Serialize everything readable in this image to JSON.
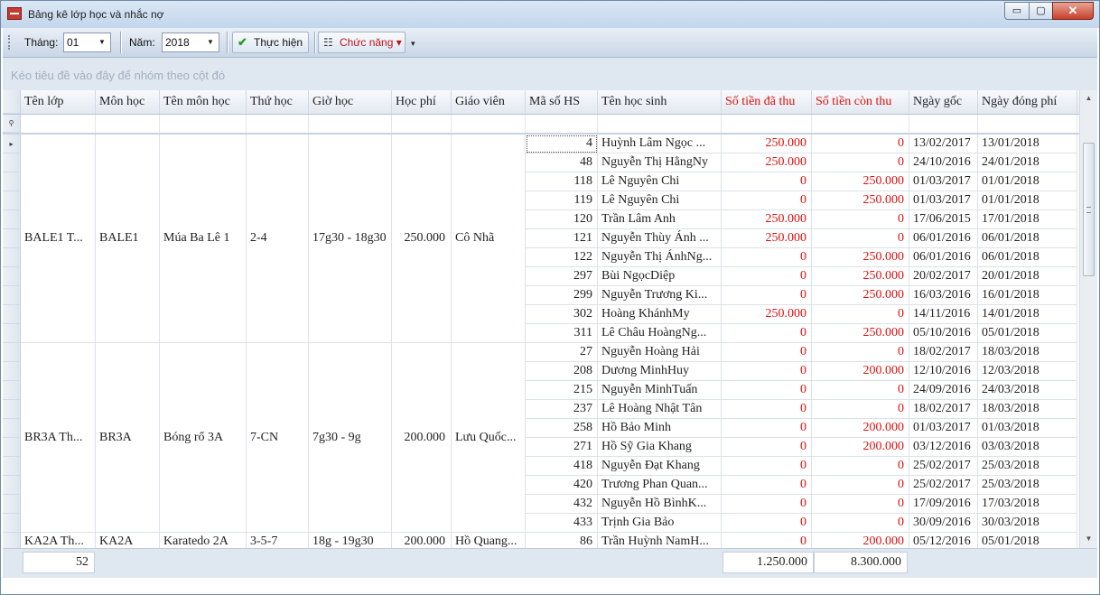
{
  "window": {
    "title": "Bảng kê lớp học và nhắc nợ",
    "min_glyph": "▭",
    "max_glyph": "▢",
    "close_glyph": "✕"
  },
  "toolbar": {
    "month_label": "Tháng:",
    "month_value": "01",
    "year_label": "Năm:",
    "year_value": "2018",
    "execute_label": "Thực hiện",
    "function_label": "Chức năng",
    "dropdown_glyph": "▼",
    "function_arrow": "▾",
    "more_glyph": "▾"
  },
  "group_panel": {
    "hint": "Kéo tiêu đề vào đây để nhóm theo cột đó"
  },
  "colors": {
    "header_red": "#e01010",
    "money_red": "#e01010",
    "accent": "#c0131a"
  },
  "columns": [
    {
      "label": "Tên lớp"
    },
    {
      "label": "Môn học"
    },
    {
      "label": "Tên môn học"
    },
    {
      "label": "Thứ học"
    },
    {
      "label": "Giờ học"
    },
    {
      "label": "Học phí"
    },
    {
      "label": "Giáo viên"
    },
    {
      "label": "Mã số HS"
    },
    {
      "label": "Tên học sinh"
    },
    {
      "label": "Số tiền đã thu",
      "red": true
    },
    {
      "label": "Số tiền còn thu",
      "red": true
    },
    {
      "label": "Ngày gốc"
    },
    {
      "label": "Ngày đóng phí"
    }
  ],
  "groups": [
    {
      "class_name": "BALE1 T...",
      "subject": "BALE1",
      "subject_name": "Múa Ba Lê 1",
      "days": "2-4",
      "time": "17g30 - 18g30",
      "fee": "250.000",
      "teacher": "Cô Nhã",
      "rows": [
        {
          "id": "4",
          "name": "Huỳnh Lâm Ngọc ...",
          "paid": "250.000",
          "remaining": "0",
          "date_orig": "13/02/2017",
          "date_paid": "13/01/2018"
        },
        {
          "id": "48",
          "name": "Nguyễn Thị HằngNy",
          "paid": "250.000",
          "remaining": "0",
          "date_orig": "24/10/2016",
          "date_paid": "24/01/2018"
        },
        {
          "id": "118",
          "name": "Lê Nguyên Chi",
          "paid": "0",
          "remaining": "250.000",
          "date_orig": "01/03/2017",
          "date_paid": "01/01/2018"
        },
        {
          "id": "119",
          "name": "Lê Nguyên Chi",
          "paid": "0",
          "remaining": "250.000",
          "date_orig": "01/03/2017",
          "date_paid": "01/01/2018"
        },
        {
          "id": "120",
          "name": "Trần Lâm Anh",
          "paid": "250.000",
          "remaining": "0",
          "date_orig": "17/06/2015",
          "date_paid": "17/01/2018"
        },
        {
          "id": "121",
          "name": "Nguyễn Thùy Ánh ...",
          "paid": "250.000",
          "remaining": "0",
          "date_orig": "06/01/2016",
          "date_paid": "06/01/2018"
        },
        {
          "id": "122",
          "name": "Nguyễn Thị ÁnhNg...",
          "paid": "0",
          "remaining": "250.000",
          "date_orig": "06/01/2016",
          "date_paid": "06/01/2018"
        },
        {
          "id": "297",
          "name": "Bùi NgọcDiệp",
          "paid": "0",
          "remaining": "250.000",
          "date_orig": "20/02/2017",
          "date_paid": "20/01/2018"
        },
        {
          "id": "299",
          "name": "Nguyễn Trương Ki...",
          "paid": "0",
          "remaining": "250.000",
          "date_orig": "16/03/2016",
          "date_paid": "16/01/2018"
        },
        {
          "id": "302",
          "name": "Hoàng KhánhMy",
          "paid": "250.000",
          "remaining": "0",
          "date_orig": "14/11/2016",
          "date_paid": "14/01/2018"
        },
        {
          "id": "311",
          "name": "Lê Châu HoàngNg...",
          "paid": "0",
          "remaining": "250.000",
          "date_orig": "05/10/2016",
          "date_paid": "05/01/2018"
        }
      ]
    },
    {
      "class_name": "BR3A Th...",
      "subject": "BR3A",
      "subject_name": "Bóng rổ 3A",
      "days": "7-CN",
      "time": "7g30 - 9g",
      "fee": "200.000",
      "teacher": "Lưu Quốc...",
      "rows": [
        {
          "id": "27",
          "name": "Nguyễn Hoàng Hải",
          "paid": "0",
          "remaining": "0",
          "date_orig": "18/02/2017",
          "date_paid": "18/03/2018"
        },
        {
          "id": "208",
          "name": "Dương MinhHuy",
          "paid": "0",
          "remaining": "200.000",
          "date_orig": "12/10/2016",
          "date_paid": "12/03/2018"
        },
        {
          "id": "215",
          "name": "Nguyễn MinhTuấn",
          "paid": "0",
          "remaining": "0",
          "date_orig": "24/09/2016",
          "date_paid": "24/03/2018"
        },
        {
          "id": "237",
          "name": "Lê Hoàng Nhật Tân",
          "paid": "0",
          "remaining": "0",
          "date_orig": "18/02/2017",
          "date_paid": "18/03/2018"
        },
        {
          "id": "258",
          "name": "Hồ Bảo Minh",
          "paid": "0",
          "remaining": "200.000",
          "date_orig": "01/03/2017",
          "date_paid": "01/03/2018"
        },
        {
          "id": "271",
          "name": "Hồ Sỹ Gia Khang",
          "paid": "0",
          "remaining": "200.000",
          "date_orig": "03/12/2016",
          "date_paid": "03/03/2018"
        },
        {
          "id": "418",
          "name": "Nguyễn Đạt Khang",
          "paid": "0",
          "remaining": "0",
          "date_orig": "25/02/2017",
          "date_paid": "25/03/2018"
        },
        {
          "id": "420",
          "name": "Trương Phan Quan...",
          "paid": "0",
          "remaining": "0",
          "date_orig": "25/02/2017",
          "date_paid": "25/03/2018"
        },
        {
          "id": "432",
          "name": "Nguyễn Hồ BìnhK...",
          "paid": "0",
          "remaining": "0",
          "date_orig": "17/09/2016",
          "date_paid": "17/03/2018"
        },
        {
          "id": "433",
          "name": "Trịnh Gia Bảo",
          "paid": "0",
          "remaining": "0",
          "date_orig": "30/09/2016",
          "date_paid": "30/03/2018"
        }
      ]
    },
    {
      "class_name": "KA2A Th...",
      "subject": "KA2A",
      "subject_name": "Karatedo 2A",
      "days": "3-5-7",
      "time": "18g - 19g30",
      "fee": "200.000",
      "teacher": "Hồ Quang...",
      "rows": [
        {
          "id": "86",
          "name": "Trần Huỳnh NamH...",
          "paid": "0",
          "remaining": "200.000",
          "date_orig": "05/12/2016",
          "date_paid": "05/01/2018"
        }
      ]
    }
  ],
  "footer": {
    "count": "52",
    "total_paid": "1.250.000",
    "total_remaining": "8.300.000"
  },
  "scroll": {
    "up_glyph": "▲",
    "down_glyph": "▼"
  },
  "indicator": {
    "filter_glyph": "⚲",
    "current_glyph": "▸"
  }
}
